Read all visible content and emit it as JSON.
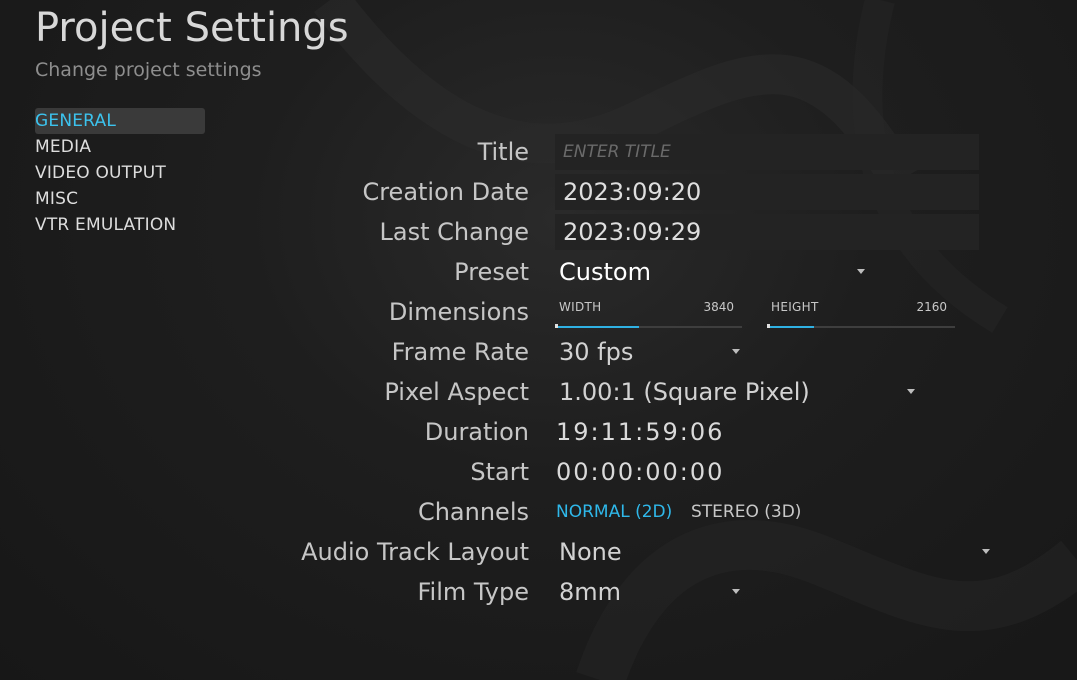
{
  "header": {
    "title": "Project Settings",
    "subtitle": "Change project settings"
  },
  "nav": {
    "items": [
      "GENERAL",
      "MEDIA",
      "VIDEO OUTPUT",
      "MISC",
      "VTR EMULATION"
    ],
    "active": "GENERAL"
  },
  "form": {
    "title_label": "Title",
    "title_placeholder": "ENTER TITLE",
    "creation_date_label": "Creation Date",
    "creation_date_value": "2023:09:20",
    "last_change_label": "Last Change",
    "last_change_value": "2023:09:29",
    "preset_label": "Preset",
    "preset_value": "Custom",
    "dimensions_label": "Dimensions",
    "width_label": "WIDTH",
    "width_value": "3840",
    "height_label": "HEIGHT",
    "height_value": "2160",
    "frame_rate_label": "Frame Rate",
    "frame_rate_value": "30 fps",
    "pixel_aspect_label": "Pixel Aspect",
    "pixel_aspect_value": "1.00:1 (Square Pixel)",
    "duration_label": "Duration",
    "duration_value": "19:11:59:06",
    "start_label": "Start",
    "start_value": "00:00:00:00",
    "channels_label": "Channels",
    "channels_options": [
      "NORMAL (2D)",
      "STEREO (3D)"
    ],
    "channels_selected": "NORMAL (2D)",
    "audio_layout_label": "Audio Track Layout",
    "audio_layout_value": "None",
    "film_type_label": "Film Type",
    "film_type_value": "8mm"
  },
  "colors": {
    "accent": "#2fb8ea",
    "background": "#1c1c1c",
    "nav_active_bg": "#3a3a3a"
  },
  "icons": {
    "dropdown": "caret-down-icon"
  }
}
